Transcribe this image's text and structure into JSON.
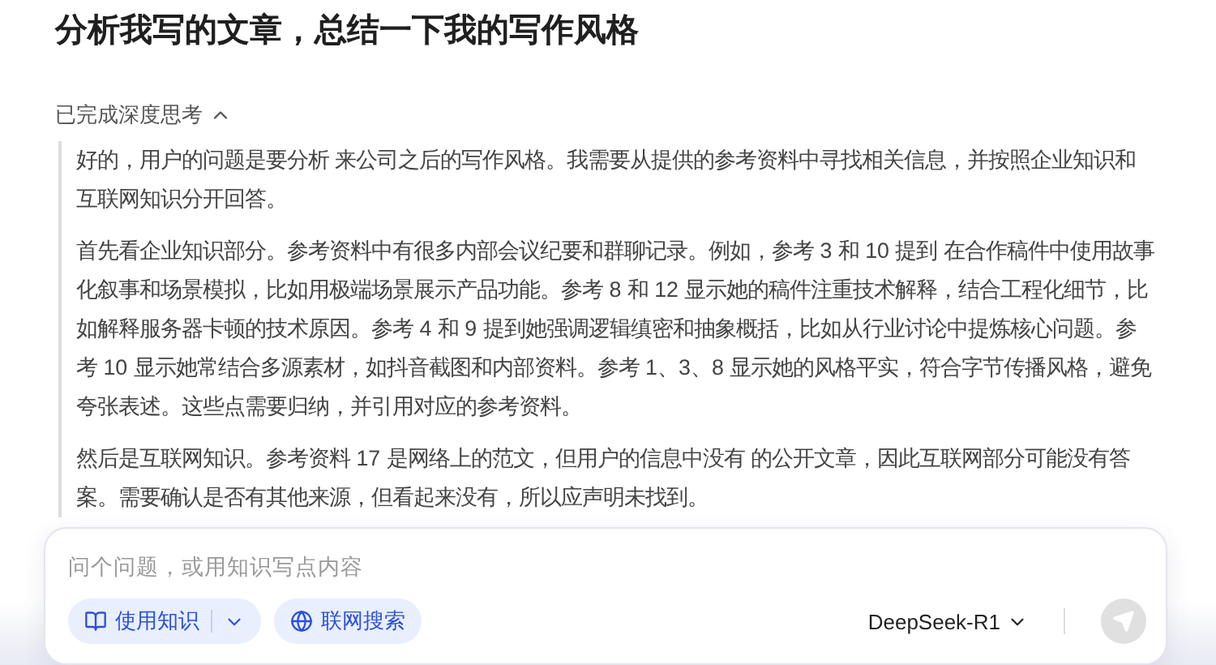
{
  "title": "分析我写的文章，总结一下我的写作风格",
  "thinking": {
    "label": "已完成深度思考",
    "expanded": true,
    "paragraphs": [
      "好的，用户的问题是要分析 来公司之后的写作风格。我需要从提供的参考资料中寻找相关信息，并按照企业知识和互联网知识分开回答。",
      "首先看企业知识部分。参考资料中有很多内部会议纪要和群聊记录。例如，参考 3 和 10 提到 在合作稿件中使用故事化叙事和场景模拟，比如用极端场景展示产品功能。参考 8 和 12 显示她的稿件注重技术解释，结合工程化细节，比如解释服务器卡顿的技术原因。参考 4 和 9 提到她强调逻辑缜密和抽象概括，比如从行业讨论中提炼核心问题。参考 10 显示她常结合多源素材，如抖音截图和内部资料。参考 1、3、8 显示她的风格平实，符合字节传播风格，避免夸张表述。这些点需要归纳，并引用对应的参考资料。",
      "然后是互联网知识。参考资料 17 是网络上的范文，但用户的信息中没有 的公开文章，因此互联网部分可能没有答案。需要确认是否有其他来源，但看起来没有，所以应声明未找到。"
    ]
  },
  "composer": {
    "placeholder": "问个问题，或用知识写点内容",
    "tools": [
      {
        "kind": "knowledge",
        "label": "使用知识"
      },
      {
        "kind": "web",
        "label": "联网搜索"
      }
    ],
    "model": "DeepSeek-R1",
    "send_disabled": true
  }
}
